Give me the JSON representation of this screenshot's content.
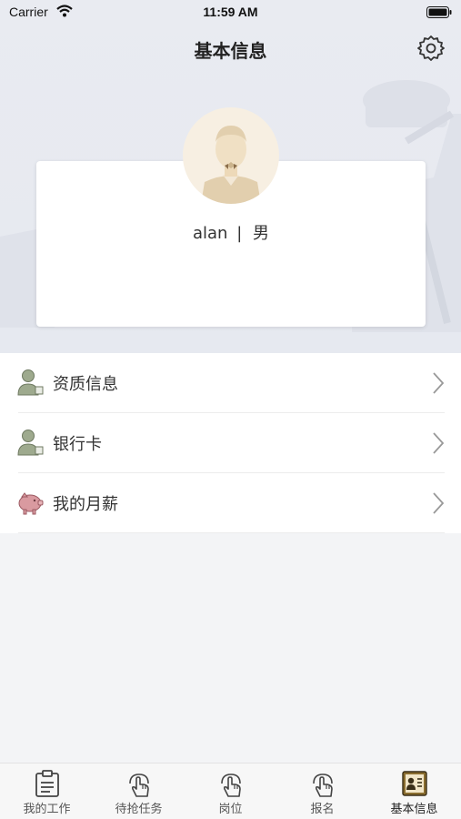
{
  "status_bar": {
    "carrier": "Carrier",
    "time": "11:59 AM"
  },
  "nav": {
    "title": "基本信息",
    "settings_icon": "gear-icon"
  },
  "profile": {
    "name": "alan",
    "separator": "|",
    "gender": "男"
  },
  "menu": {
    "items": [
      {
        "label": "资质信息",
        "icon": "person-card-icon"
      },
      {
        "label": "银行卡",
        "icon": "person-card-icon"
      },
      {
        "label": "我的月薪",
        "icon": "piggy-bank-icon"
      }
    ]
  },
  "tabs": [
    {
      "label": "我的工作",
      "icon": "clipboard-icon",
      "active": false
    },
    {
      "label": "待抢任务",
      "icon": "hand-tap-icon",
      "active": false
    },
    {
      "label": "岗位",
      "icon": "hand-tap-icon",
      "active": false
    },
    {
      "label": "报名",
      "icon": "hand-tap-icon",
      "active": false
    },
    {
      "label": "基本信息",
      "icon": "id-card-icon",
      "active": true
    }
  ],
  "colors": {
    "accent": "#8a6d2f",
    "background": "#f3f4f6",
    "header_bg": "#e8eaf0",
    "avatar_bg": "#f7efe2"
  }
}
